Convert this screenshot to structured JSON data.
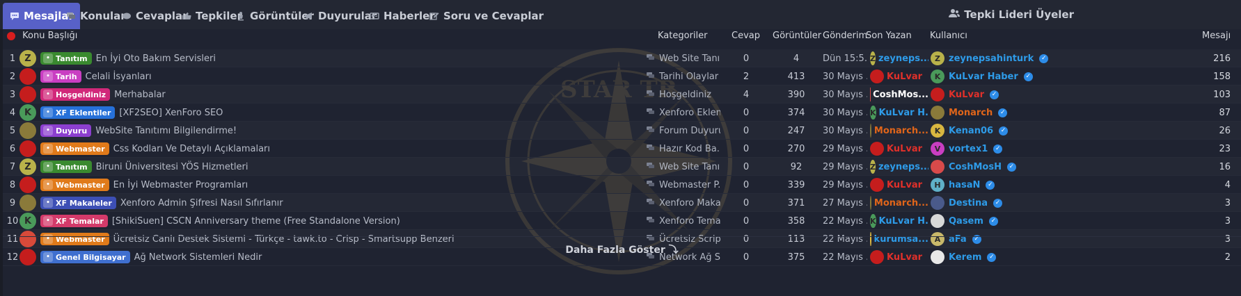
{
  "tabs": [
    {
      "label": "Mesajlar",
      "icon": "chat-icon",
      "glyph": "…"
    },
    {
      "label": "Konular",
      "icon": "comments-icon",
      "glyph": "▬"
    },
    {
      "label": "Cevaplar",
      "icon": "reply-icon",
      "glyph": "●"
    },
    {
      "label": "Tepkiler",
      "icon": "thumbs-up-icon",
      "glyph": "▲"
    },
    {
      "label": "Görüntüler",
      "icon": "eye-icon",
      "glyph": "♦"
    },
    {
      "label": "Duyurular",
      "icon": "megaphone-icon",
      "glyph": "◄"
    },
    {
      "label": "Haberler",
      "icon": "newspaper-icon",
      "glyph": "▤"
    },
    {
      "label": "Soru ve Cevaplar",
      "icon": "edit-icon",
      "glyph": "✎"
    }
  ],
  "right_tab": {
    "label": "Tepki Lideri Üyeler",
    "icon": "users-icon"
  },
  "headers": {
    "topic": "Konu Başlığı",
    "category": "Kategoriler",
    "replies": "Cevap",
    "views": "Görüntüler",
    "sent": "Gönderim",
    "last_poster": "Son Yazan",
    "user": "Kullanıcı",
    "messages": "Mesajı"
  },
  "colors": {
    "accent": "#5861c8",
    "red_user": "#e0302a",
    "blue_user": "#2e9be8",
    "orange_user": "#e0651a",
    "verified": "#2d8ce8"
  },
  "rows": [
    {
      "n": "1",
      "avatar": "Z",
      "av_color": "#b9b24a",
      "prefix": "Tanıtım",
      "prefix_color": "#3a8a2f",
      "title": "En İyi Oto Bakım Servisleri",
      "category": "Web Site Tanı...",
      "replies": "0",
      "views": "4",
      "date": "Dün 15:5...",
      "lp": "zeyneps...",
      "lp_av": "Z",
      "lp_av_color": "#b9b24a",
      "lp_color": "#2e9be8",
      "user": "zeynepsahinturk",
      "u_av": "Z",
      "u_av_color": "#b9b24a",
      "u_color": "#2e9be8",
      "count": "216"
    },
    {
      "n": "2",
      "avatar": "",
      "av_color": "#c51d1d",
      "prefix": "Tarih",
      "prefix_color": "#c93ec2",
      "title": "Celali İsyanları",
      "category": "Tarihi Olaylar",
      "replies": "2",
      "views": "413",
      "date": "30 Mayıs ...",
      "lp": "KuLvar",
      "lp_av": "",
      "lp_av_color": "#c51d1d",
      "lp_color": "#e0302a",
      "user": "KuLvar Haber",
      "u_av": "K",
      "u_av_color": "#4a9a5a",
      "u_color": "#2e9be8",
      "count": "158"
    },
    {
      "n": "3",
      "avatar": "",
      "av_color": "#c51d1d",
      "prefix": "Hoşgeldiniz",
      "prefix_color": "#d1287a",
      "title": "Merhabalar",
      "category": "Hoşgeldiniz",
      "replies": "4",
      "views": "390",
      "date": "30 Mayıs ...",
      "lp": "CoshMos...",
      "lp_av": "",
      "lp_av_color": "#d84a4a",
      "lp_color": "#ffffff",
      "user": "KuLvar",
      "u_av": "",
      "u_av_color": "#c51d1d",
      "u_color": "#e0302a",
      "count": "103"
    },
    {
      "n": "4",
      "avatar": "K",
      "av_color": "#4a9a5a",
      "prefix": "XF Eklentiler",
      "prefix_color": "#2670d9",
      "title": "[XF2SEO] XenForo SEO",
      "category": "Xenforo Eklen...",
      "replies": "0",
      "views": "374",
      "date": "30 Mayıs ...",
      "lp": "KuLvar H...",
      "lp_av": "K",
      "lp_av_color": "#4a9a5a",
      "lp_color": "#2e9be8",
      "user": "Monarch",
      "u_av": "",
      "u_av_color": "#8a7a3a",
      "u_color": "#e0651a",
      "count": "87"
    },
    {
      "n": "5",
      "avatar": "",
      "av_color": "#8a7a3a",
      "prefix": "Duyuru",
      "prefix_color": "#8c3fcf",
      "title": "WebSite Tanıtımı Bilgilendirme!",
      "category": "Forum Duyuru...",
      "replies": "0",
      "views": "247",
      "date": "30 Mayıs ...",
      "lp": "Monarch...",
      "lp_av": "",
      "lp_av_color": "#8a7a3a",
      "lp_color": "#e0651a",
      "user": "Kenan06",
      "u_av": "K",
      "u_av_color": "#d8b640",
      "u_color": "#2e9be8",
      "count": "26"
    },
    {
      "n": "6",
      "avatar": "",
      "av_color": "#c51d1d",
      "prefix": "Webmaster",
      "prefix_color": "#e07a1a",
      "title": "Css Kodları Ve Detaylı Açıklamaları",
      "category": "Hazır Kod Ba...",
      "replies": "0",
      "views": "270",
      "date": "29 Mayıs ...",
      "lp": "KuLvar",
      "lp_av": "",
      "lp_av_color": "#c51d1d",
      "lp_color": "#e0302a",
      "user": "vortex1",
      "u_av": "V",
      "u_av_color": "#c93ec2",
      "u_color": "#2e9be8",
      "count": "23"
    },
    {
      "n": "7",
      "avatar": "Z",
      "av_color": "#b9b24a",
      "prefix": "Tanıtım",
      "prefix_color": "#3a8a2f",
      "title": "Biruni Üniversitesi YÖS Hizmetleri",
      "category": "Web Site Tanı...",
      "replies": "0",
      "views": "92",
      "date": "29 Mayıs ...",
      "lp": "zeyneps...",
      "lp_av": "Z",
      "lp_av_color": "#b9b24a",
      "lp_color": "#2e9be8",
      "user": "CoshMosH",
      "u_av": "",
      "u_av_color": "#d84a4a",
      "u_color": "#2e9be8",
      "count": "16"
    },
    {
      "n": "8",
      "avatar": "",
      "av_color": "#c51d1d",
      "prefix": "Webmaster",
      "prefix_color": "#e07a1a",
      "title": "En İyi Webmaster Programları",
      "category": "Webmaster P...",
      "replies": "0",
      "views": "339",
      "date": "29 Mayıs ...",
      "lp": "KuLvar",
      "lp_av": "",
      "lp_av_color": "#c51d1d",
      "lp_color": "#e0302a",
      "user": "hasaN",
      "u_av": "H",
      "u_av_color": "#5fb0c8",
      "u_color": "#2e9be8",
      "count": "4"
    },
    {
      "n": "9",
      "avatar": "",
      "av_color": "#8a7a3a",
      "prefix": "XF Makaleler",
      "prefix_color": "#3d4fb5",
      "title": "Xenforo Admin Şifresi Nasıl Sıfırlanır",
      "category": "Xenforo Maka...",
      "replies": "0",
      "views": "371",
      "date": "27 Mayıs ...",
      "lp": "Monarch...",
      "lp_av": "",
      "lp_av_color": "#8a7a3a",
      "lp_color": "#e0651a",
      "user": "Destina",
      "u_av": "",
      "u_av_color": "#4a5a8a",
      "u_color": "#2e9be8",
      "count": "3"
    },
    {
      "n": "10",
      "avatar": "K",
      "av_color": "#4a9a5a",
      "prefix": "XF Temalar",
      "prefix_color": "#d43a6a",
      "title": "[ShikiSuen] CSCN Anniversary theme (Free Standalone Version)",
      "category": "Xenforo Tema...",
      "replies": "0",
      "views": "358",
      "date": "22 Mayıs ...",
      "lp": "KuLvar H...",
      "lp_av": "K",
      "lp_av_color": "#4a9a5a",
      "lp_color": "#2e9be8",
      "user": "Qasem",
      "u_av": "",
      "u_av_color": "#d8d8d8",
      "u_color": "#2e9be8",
      "count": "3"
    },
    {
      "n": "11",
      "avatar": "",
      "av_color": "#d84a3a",
      "prefix": "Webmaster",
      "prefix_color": "#e07a1a",
      "title": "Ücretsiz Canlı Destek Sistemi - Türkçe - tawk.to - Crisp - Smartsupp Benzeri",
      "category": "Ücretsiz Scrip...",
      "replies": "0",
      "views": "113",
      "date": "22 Mayıs ...",
      "lp": "kurumsa...",
      "lp_av": "",
      "lp_av_color": "#e8c040",
      "lp_color": "#2e9be8",
      "user": "aFa",
      "u_av": "A",
      "u_av_color": "#c8b86a",
      "u_color": "#2e9be8",
      "count": "3"
    },
    {
      "n": "12",
      "avatar": "",
      "av_color": "#c51d1d",
      "prefix": "Genel Bilgisayar",
      "prefix_color": "#3f6fcf",
      "title": "Ağ Network Sistemleri Nedir",
      "category": "Network Ağ S...",
      "replies": "0",
      "views": "375",
      "date": "22 Mayıs ...",
      "lp": "KuLvar",
      "lp_av": "",
      "lp_av_color": "#c51d1d",
      "lp_color": "#e0302a",
      "user": "Kerem",
      "u_av": "",
      "u_av_color": "#e8e8e8",
      "u_color": "#2e9be8",
      "count": "2"
    }
  ],
  "more_label": "Daha Fazla Göster ⤵"
}
